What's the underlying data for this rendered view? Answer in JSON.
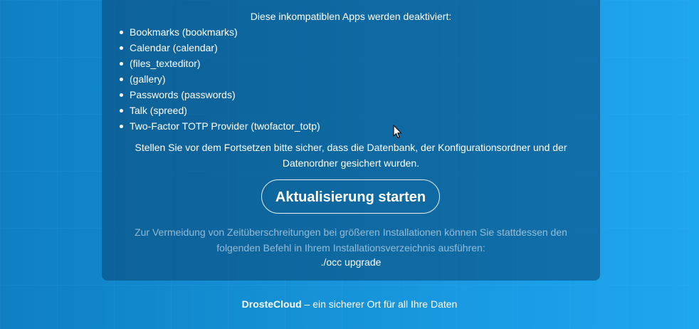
{
  "update": {
    "heading": "Diese inkompatiblen Apps werden deaktiviert:",
    "apps": [
      "Bookmarks (bookmarks)",
      "Calendar (calendar)",
      "(files_texteditor)",
      "(gallery)",
      "Passwords (passwords)",
      "Talk (spreed)",
      "Two-Factor TOTP Provider (twofactor_totp)"
    ],
    "backup_note": "Stellen Sie vor dem Fortsetzen bitte sicher, dass die Datenbank, der Konfigurationsordner und der Datenordner gesichert wurden.",
    "start_button_label": "Aktualisierung starten",
    "timeout_hint": "Zur Vermeidung von Zeitüberschreitungen bei größeren Installationen können Sie stattdessen den folgenden Befehl in Ihrem Installationsverzeichnis ausführen:",
    "command": "./occ upgrade"
  },
  "footer": {
    "brand": "DrosteCloud",
    "tagline": " – ein sicherer Ort für all Ihre Daten"
  },
  "icons": {
    "cursor": "mouse-pointer-icon"
  },
  "colors": {
    "background": "#1590d5",
    "panel": "#0a4673"
  }
}
